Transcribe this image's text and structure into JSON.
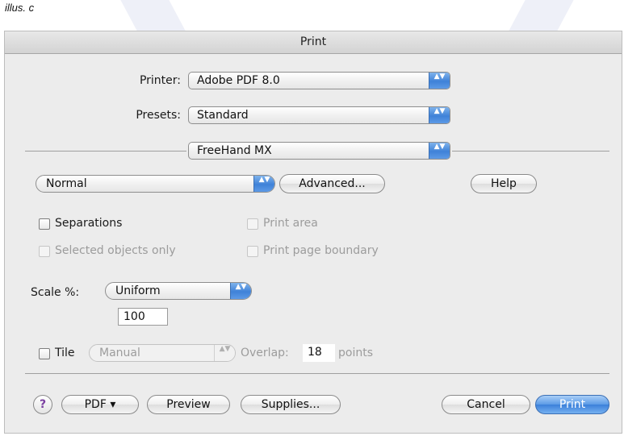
{
  "caption": "illus. c",
  "dialog": {
    "title": "Print",
    "printer_label": "Printer:",
    "printer_value": "Adobe PDF 8.0",
    "presets_label": "Presets:",
    "presets_value": "Standard",
    "panel_value": "FreeHand MX",
    "mode_value": "Normal",
    "advanced_label": "Advanced...",
    "help_label": "Help",
    "separations_label": "Separations",
    "print_area_label": "Print area",
    "selected_only_label": "Selected objects only",
    "print_page_boundary_label": "Print page boundary",
    "scale_label": "Scale %:",
    "scale_mode_value": "Uniform",
    "scale_value": "100",
    "tile_label": "Tile",
    "tile_mode_value": "Manual",
    "overlap_label": "Overlap:",
    "overlap_value": "18",
    "overlap_unit": "points",
    "help_icon_glyph": "?",
    "pdf_label": "PDF ▾",
    "preview_label": "Preview",
    "supplies_label": "Supplies...",
    "cancel_label": "Cancel",
    "print_label": "Print"
  },
  "arrow_glyph": "▲▼"
}
